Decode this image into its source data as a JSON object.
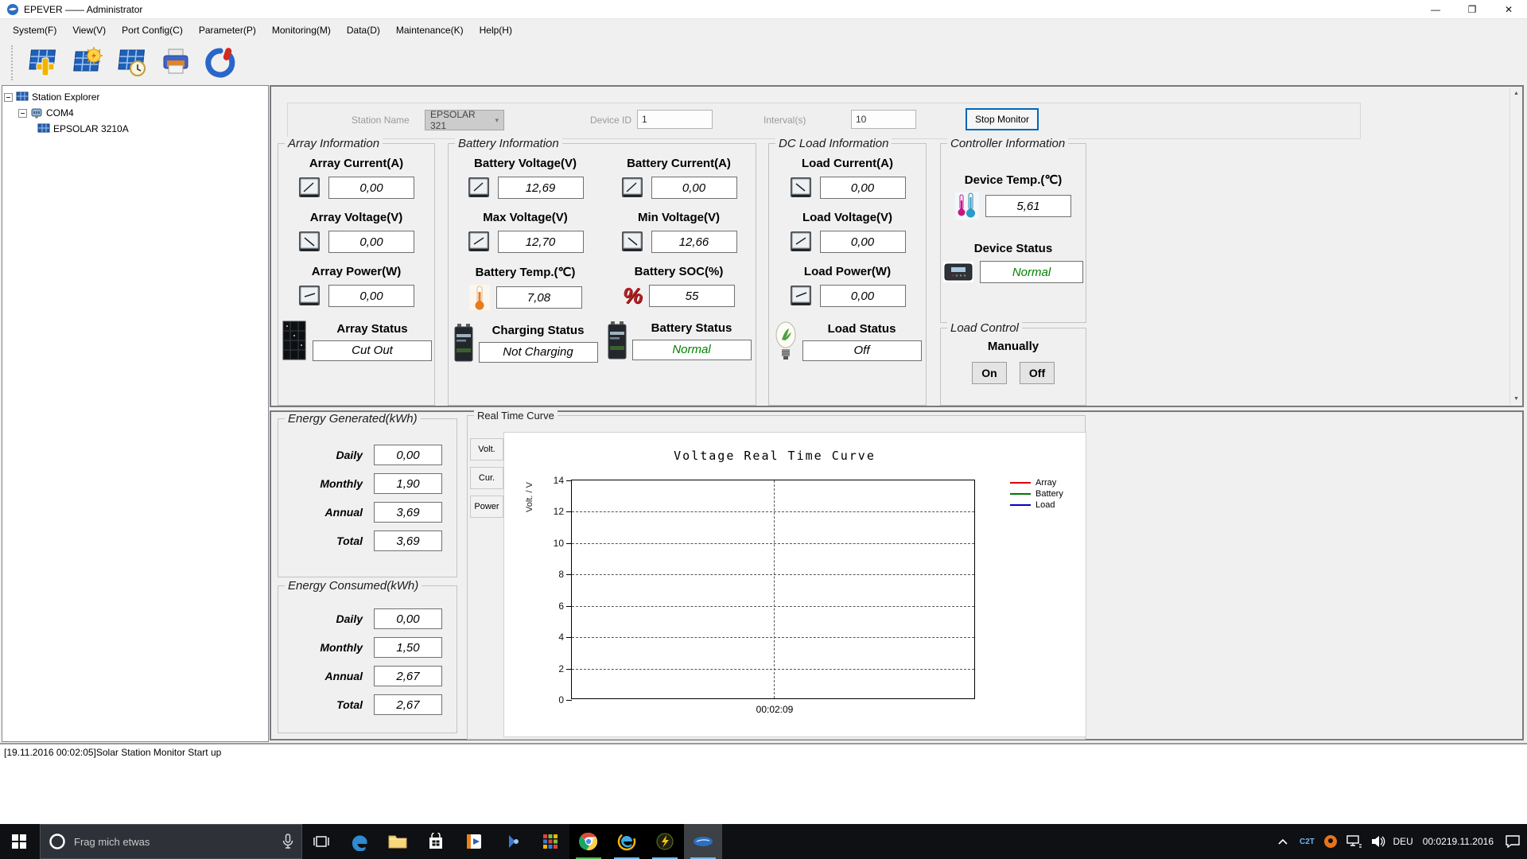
{
  "window": {
    "title": "EPEVER —— Administrator"
  },
  "menu": {
    "items": [
      "System(F)",
      "View(V)",
      "Port Config(C)",
      "Parameter(P)",
      "Monitoring(M)",
      "Data(D)",
      "Maintenance(K)",
      "Help(H)"
    ]
  },
  "tree": {
    "root": "Station Explorer",
    "port": "COM4",
    "device": "EPSOLAR 3210A"
  },
  "station_bar": {
    "station_name_label": "Station Name",
    "station_name_value": "EPSOLAR 321",
    "device_id_label": "Device ID",
    "device_id_value": "1",
    "interval_label": "Interval(s)",
    "interval_value": "10",
    "stop_button": "Stop Monitor"
  },
  "panels": {
    "array": {
      "title": "Array Information",
      "fields": [
        {
          "label": "Array Current(A)",
          "value": "0,00"
        },
        {
          "label": "Array Voltage(V)",
          "value": "0,00"
        },
        {
          "label": "Array Power(W)",
          "value": "0,00"
        }
      ],
      "status": {
        "label": "Array Status",
        "value": "Cut Out",
        "color": "#000000"
      }
    },
    "battery": {
      "title": "Battery Information",
      "col1": [
        {
          "label": "Battery Voltage(V)",
          "value": "12,69"
        },
        {
          "label": "Max Voltage(V)",
          "value": "12,70"
        },
        {
          "label": "Battery Temp.(℃)",
          "value": "7,08"
        }
      ],
      "col2": [
        {
          "label": "Battery Current(A)",
          "value": "0,00"
        },
        {
          "label": "Min Voltage(V)",
          "value": "12,66"
        },
        {
          "label": "Battery SOC(%)",
          "value": "55"
        }
      ],
      "charging_status": {
        "label": "Charging Status",
        "value": "Not Charging",
        "color": "#000000"
      },
      "battery_status": {
        "label": "Battery Status",
        "value": "Normal",
        "color": "#008000"
      }
    },
    "dc_load": {
      "title": "DC Load Information",
      "fields": [
        {
          "label": "Load Current(A)",
          "value": "0,00"
        },
        {
          "label": "Load Voltage(V)",
          "value": "0,00"
        },
        {
          "label": "Load Power(W)",
          "value": "0,00"
        }
      ],
      "status": {
        "label": "Load Status",
        "value": "Off",
        "color": "#000000"
      }
    },
    "controller": {
      "title": "Controller Information",
      "temp_label": "Device Temp.(℃)",
      "temp_value": "5,61",
      "status_label": "Device Status",
      "status_value": "Normal",
      "status_color": "#008000"
    },
    "load_control": {
      "title": "Load Control",
      "mode_label": "Manually",
      "on_button": "On",
      "off_button": "Off"
    }
  },
  "energy_generated": {
    "title": "Energy Generated(kWh)",
    "rows": [
      {
        "label": "Daily",
        "value": "0,00"
      },
      {
        "label": "Monthly",
        "value": "1,90"
      },
      {
        "label": "Annual",
        "value": "3,69"
      },
      {
        "label": "Total",
        "value": "3,69"
      }
    ]
  },
  "energy_consumed": {
    "title": "Energy Consumed(kWh)",
    "rows": [
      {
        "label": "Daily",
        "value": "0,00"
      },
      {
        "label": "Monthly",
        "value": "1,50"
      },
      {
        "label": "Annual",
        "value": "2,67"
      },
      {
        "label": "Total",
        "value": "2,67"
      }
    ]
  },
  "chart_data": {
    "type": "line",
    "panel_title": "Real Time Curve",
    "tabs": [
      "Volt.",
      "Cur.",
      "Power"
    ],
    "title": "Voltage Real Time Curve",
    "ylabel": "Volt. / V",
    "ylim": [
      0,
      14
    ],
    "yticks": [
      0,
      2,
      4,
      6,
      8,
      10,
      12,
      14
    ],
    "x_ticks": [
      "00:02:09"
    ],
    "grid": "dashed",
    "legend_position": "right",
    "series": [
      {
        "name": "Array",
        "color": "#dd0000",
        "values": []
      },
      {
        "name": "Battery",
        "color": "#007700",
        "values": []
      },
      {
        "name": "Load",
        "color": "#0000cc",
        "values": []
      }
    ]
  },
  "log": {
    "entry": "[19.11.2016 00:02:05]Solar Station Monitor Start up"
  },
  "taskbar": {
    "search_placeholder": "Frag mich etwas",
    "tray": {
      "c2t": "C2T",
      "lang": "DEU",
      "time": "00:02",
      "date": "19.11.2016"
    }
  }
}
